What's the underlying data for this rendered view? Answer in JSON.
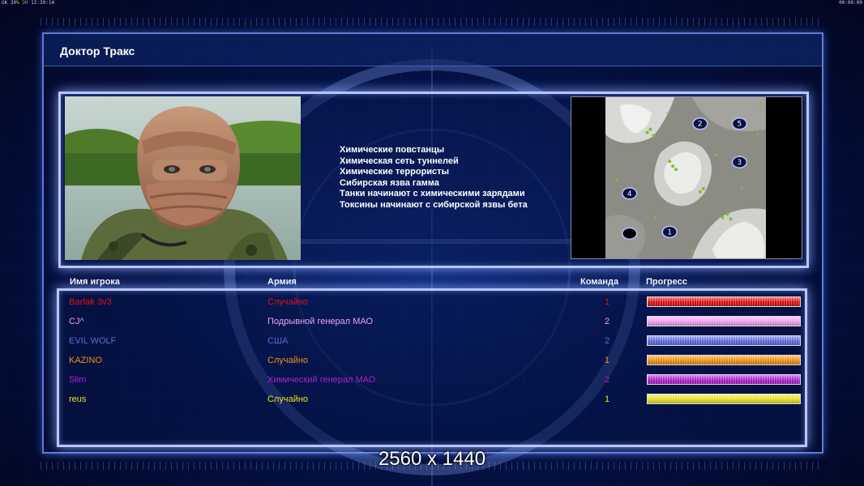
{
  "topbar": {
    "left_a": "GK 30",
    "left_pct": "%",
    "left_b": "DH",
    "left_time": "12:39:14",
    "right_time": "00:00:00"
  },
  "title": "Доктор Тракс",
  "objectives": [
    "Химические повстанцы",
    "Химическая сеть туннелей",
    "Химические террористы",
    "Сибирская язва гамма",
    "Танки начинают с химическими зарядами",
    "Токсины начинают с сибирской язвы бета"
  ],
  "minimap": {
    "markers": [
      "1",
      "2",
      "3",
      "4",
      "5"
    ]
  },
  "table": {
    "headers": {
      "name": "Имя игрока",
      "army": "Армия",
      "team": "Команда",
      "progress": "Прогресс"
    },
    "rows": [
      {
        "name": "Barfak 3v3",
        "army": "Случайно",
        "team": "1",
        "color": "#e01010",
        "progress": 1.0
      },
      {
        "name": "CJ^",
        "army": "Подрывной генерал МАО",
        "team": "2",
        "color": "#f0a0f0",
        "progress": 1.0
      },
      {
        "name": "EVIL WOLF",
        "army": "США",
        "team": "2",
        "color": "#5a6ae0",
        "progress": 1.0
      },
      {
        "name": "KAZINO",
        "army": "Случайно",
        "team": "1",
        "color": "#f09010",
        "progress": 1.0
      },
      {
        "name": "Slim",
        "army": "Химический генерал МАО",
        "team": "2",
        "color": "#b020d0",
        "progress": 1.0
      },
      {
        "name": "reus",
        "army": "Случайно",
        "team": "1",
        "color": "#e8e020",
        "progress": 1.0
      }
    ]
  },
  "overlay": "2560 x 1440"
}
